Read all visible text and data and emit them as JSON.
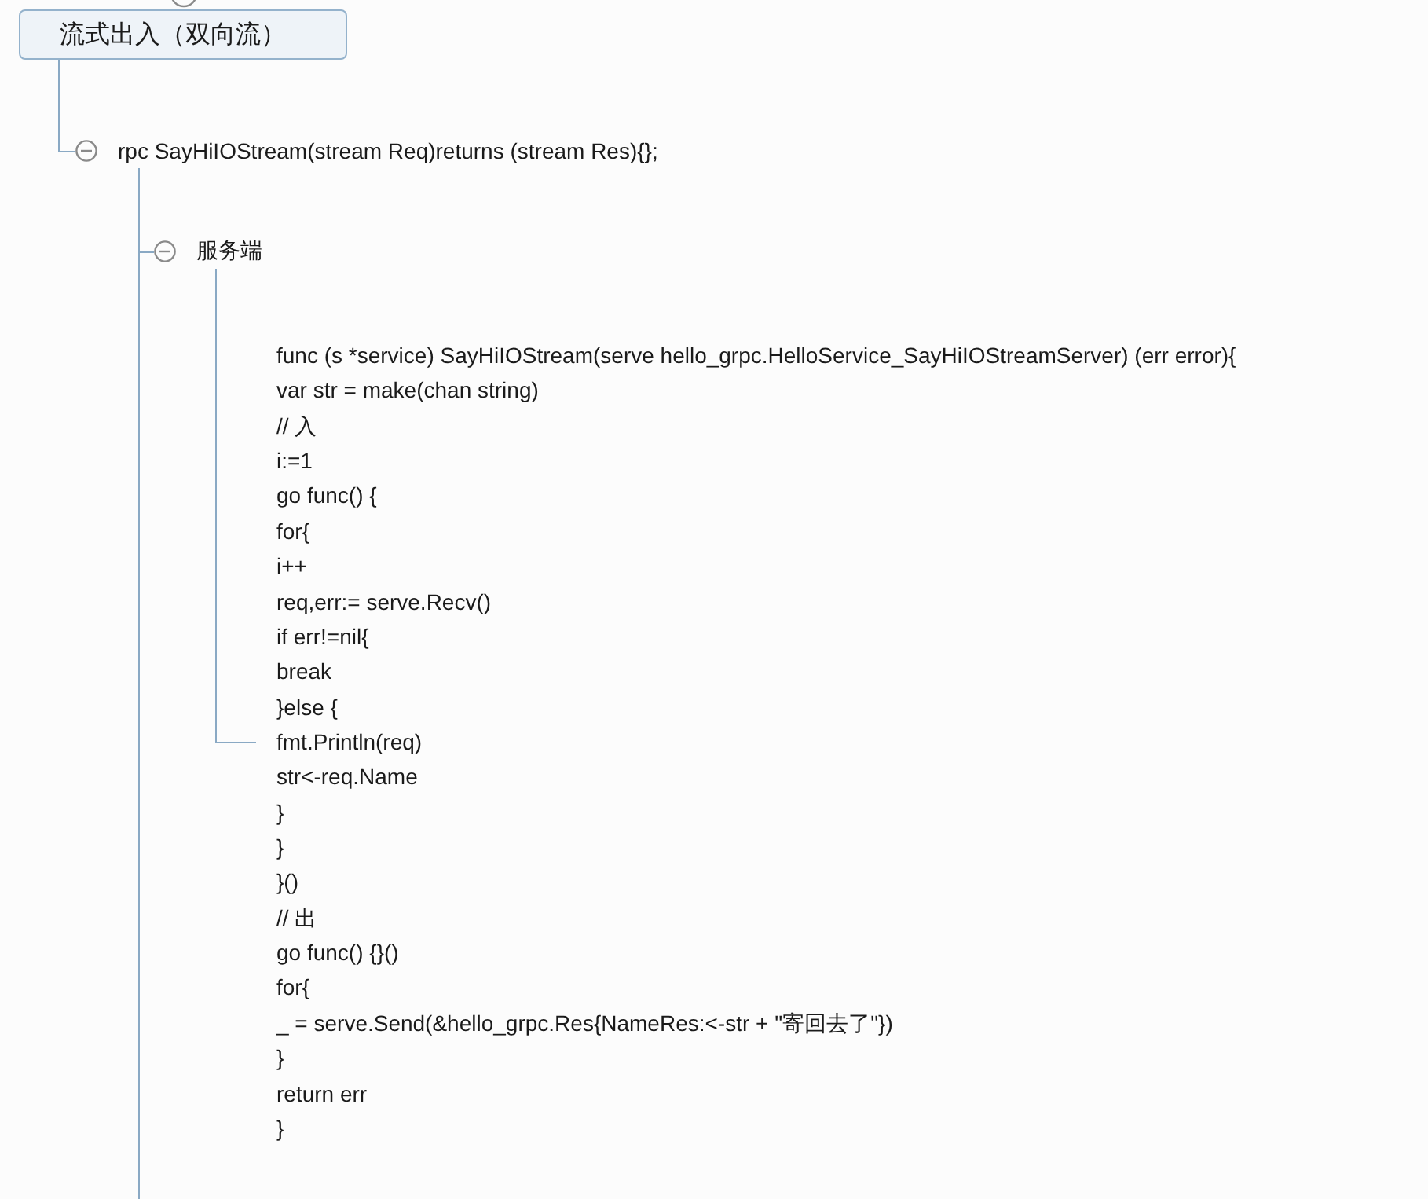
{
  "root_topic": {
    "title": "流式出入（双向流）"
  },
  "branch": {
    "title": "rpc SayHiIOStream(stream Req)returns (stream Res){};",
    "expanded": true,
    "children": [
      {
        "title": "服务端",
        "expanded": true,
        "code_lines": [
          "func (s *service) SayHiIOStream(serve hello_grpc.HelloService_SayHiIOStreamServer) (err error){",
          "var str = make(chan string)",
          "// 入",
          "i:=1",
          "go func() {",
          "for{",
          "i++",
          "req,err:= serve.Recv()",
          "if err!=nil{",
          "break",
          "}else {",
          "fmt.Println(req)",
          "str<-req.Name",
          "}",
          "}",
          "}()",
          "// 出",
          "go func() {}()",
          "for{",
          "_ = serve.Send(&hello_grpc.Res{NameRes:<-str + \"寄回去了\"})",
          "}",
          "return err",
          "}"
        ]
      }
    ]
  }
}
